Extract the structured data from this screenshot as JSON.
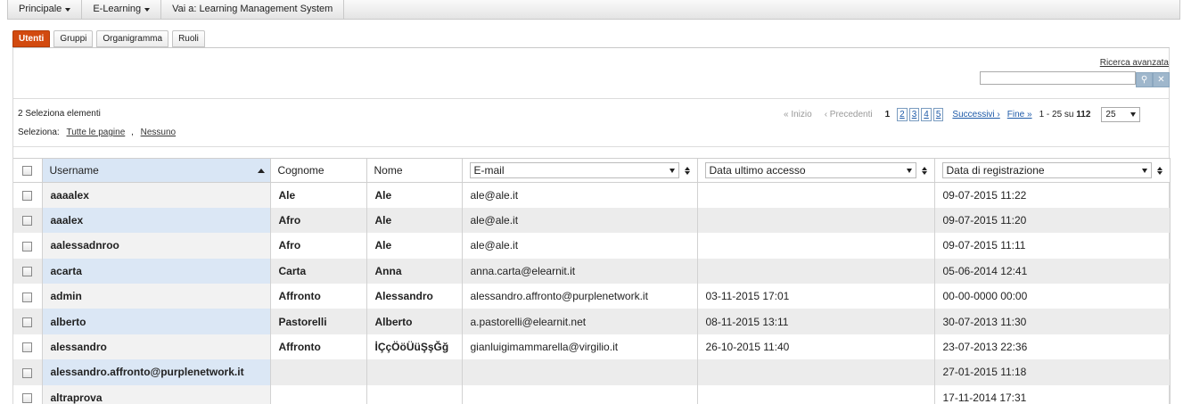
{
  "menu": [
    {
      "label": "Principale",
      "dropdown": true
    },
    {
      "label": "E-Learning",
      "dropdown": true
    },
    {
      "label": "Vai a: Learning Management System",
      "dropdown": false
    }
  ],
  "tabs": [
    {
      "label": "Utenti",
      "active": true
    },
    {
      "label": "Gruppi",
      "active": false
    },
    {
      "label": "Organigramma",
      "active": false
    },
    {
      "label": "Ruoli",
      "active": false
    }
  ],
  "search": {
    "advanced_label": "Ricerca avanzata",
    "value": "",
    "search_icon": "search-icon",
    "clear_icon": "clear-icon"
  },
  "selection": {
    "count_text": "2 Seleziona elementi",
    "label": "Seleziona:",
    "all_pages": "Tutte le pagine",
    "separator": ",",
    "none": "Nessuno"
  },
  "pager": {
    "first": "« Inizio",
    "prev": "‹ Precedenti",
    "current": "1",
    "pages": [
      "2",
      "3",
      "4",
      "5"
    ],
    "next": "Successivi ›",
    "last": "Fine »",
    "range_prefix": "1 - 25 su",
    "total": "112",
    "per_page": "25"
  },
  "table": {
    "columns": {
      "username": "Username",
      "cognome": "Cognome",
      "nome": "Nome",
      "email": "E-mail",
      "ultimo_accesso": "Data ultimo accesso",
      "registrazione": "Data di registrazione"
    },
    "rows": [
      {
        "username": "aaaalex",
        "cognome": "Ale",
        "nome": "Ale",
        "email": "ale@ale.it",
        "ultimo": "",
        "reg": "09-07-2015 11:22"
      },
      {
        "username": "aaalex",
        "cognome": "Afro",
        "nome": "Ale",
        "email": "ale@ale.it",
        "ultimo": "",
        "reg": "09-07-2015 11:20"
      },
      {
        "username": "aalessadnroo",
        "cognome": "Afro",
        "nome": "Ale",
        "email": "ale@ale.it",
        "ultimo": "",
        "reg": "09-07-2015 11:11"
      },
      {
        "username": "acarta",
        "cognome": "Carta",
        "nome": "Anna",
        "email": "anna.carta@elearnit.it",
        "ultimo": "",
        "reg": "05-06-2014 12:41"
      },
      {
        "username": "admin",
        "cognome": "Affronto",
        "nome": "Alessandro",
        "email": "alessandro.affronto@purplenetwork.it",
        "ultimo": "03-11-2015 17:01",
        "reg": "00-00-0000 00:00"
      },
      {
        "username": "alberto",
        "cognome": "Pastorelli",
        "nome": "Alberto",
        "email": "a.pastorelli@elearnit.net",
        "ultimo": "08-11-2015 13:11",
        "reg": "30-07-2013 11:30"
      },
      {
        "username": "alessandro",
        "cognome": "Affronto",
        "nome": "İÇçÖöÜüŞşĞğ",
        "email": "gianluigimammarella@virgilio.it",
        "ultimo": "26-10-2015 11:40",
        "reg": "23-07-2013 22:36"
      },
      {
        "username": "alessandro.affronto@purplenetwork.it",
        "cognome": "",
        "nome": "",
        "email": "",
        "ultimo": "",
        "reg": "27-01-2015 11:18"
      },
      {
        "username": "altraprova",
        "cognome": "",
        "nome": "",
        "email": "",
        "ultimo": "",
        "reg": "17-11-2014 17:31"
      }
    ]
  },
  "colors": {
    "active_tab": "#d24a0f",
    "sorted_header": "#d9e6f5",
    "link": "#1e5aa8"
  }
}
